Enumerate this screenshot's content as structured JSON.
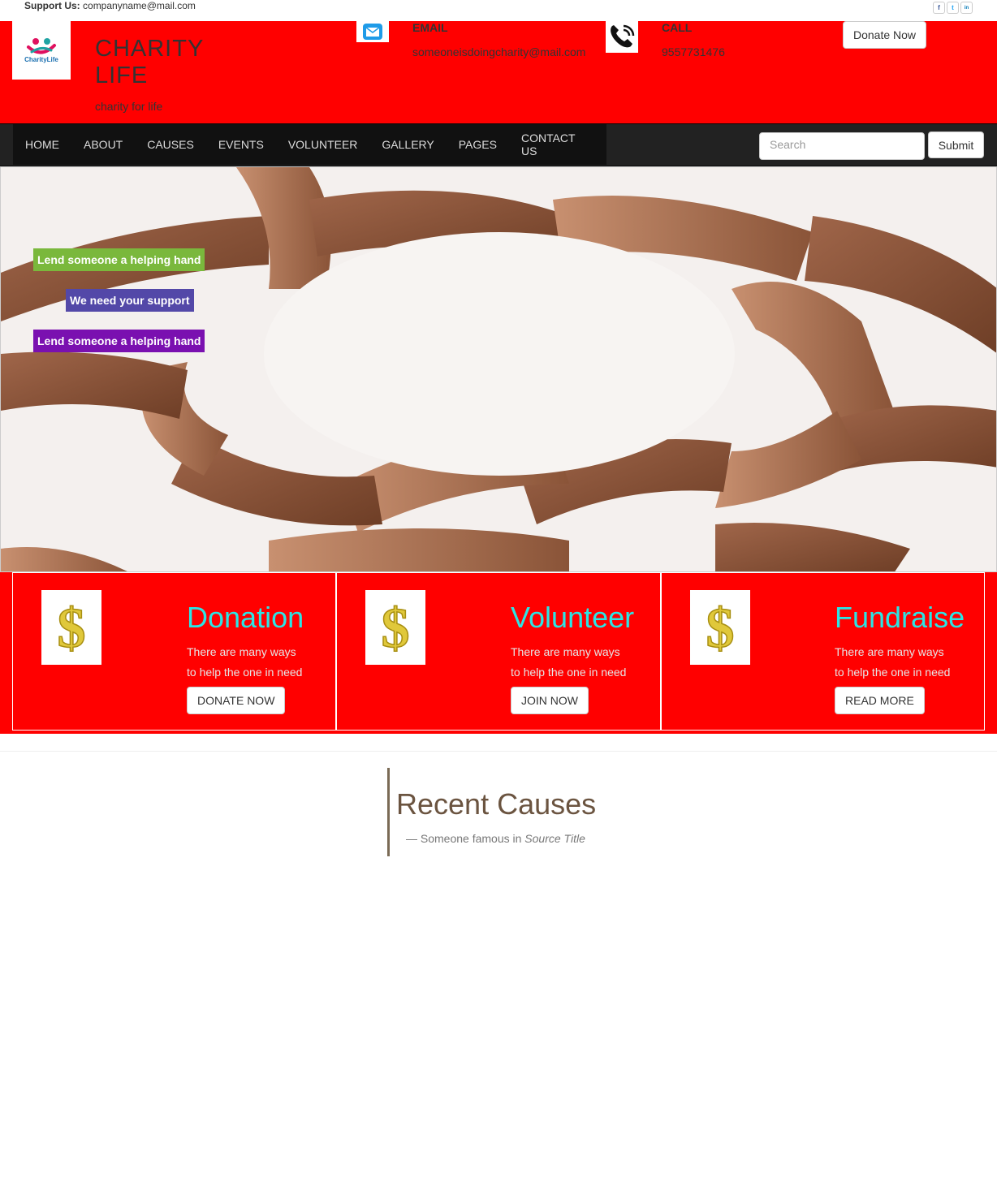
{
  "topbar": {
    "support_label": "Support Us:",
    "support_email": "companyname@mail.com",
    "socials": [
      {
        "icon": "facebook-icon",
        "glyph": "f"
      },
      {
        "icon": "twitter-icon",
        "glyph": "t"
      },
      {
        "icon": "linkedin-icon",
        "glyph": "in"
      }
    ]
  },
  "header": {
    "logo_text": "CharityLife",
    "title": "CHARITY LIFE",
    "tagline": "charity for life",
    "email_label": "EMAIL",
    "email_value": "someoneisdoingcharity@mail.com",
    "call_label": "CALL",
    "call_value": "9557731476",
    "donate_button": "Donate Now"
  },
  "nav": {
    "items": [
      "HOME",
      "ABOUT",
      "CAUSES",
      "EVENTS",
      "VOLUNTEER",
      "GALLERY",
      "PAGES",
      "CONTACT US"
    ],
    "search_placeholder": "Search",
    "submit_label": "Submit"
  },
  "hero": {
    "tags": [
      "Lend someone a helping hand",
      "We need your support",
      "Lend someone a helping hand"
    ],
    "colors": [
      "#7ab83c",
      "#5348a8",
      "#7a10b0"
    ]
  },
  "services": [
    {
      "title": "Donation",
      "line1": "There are many ways",
      "line2": "to help the one in need",
      "button": "DONATE NOW"
    },
    {
      "title": "Volunteer",
      "line1": "There are many ways",
      "line2": "to help the one in need",
      "button": "JOIN NOW"
    },
    {
      "title": "Fundraise",
      "line1": "There are many ways",
      "line2": "to help the one in need",
      "button": "READ MORE"
    }
  ],
  "recent": {
    "title": "Recent Causes",
    "footer_prefix": "— Someone famous in",
    "footer_source": "Source Title"
  },
  "colors": {
    "brand_red": "#ff0000",
    "nav_dark": "#222222",
    "service_title": "#2ae6e6"
  }
}
